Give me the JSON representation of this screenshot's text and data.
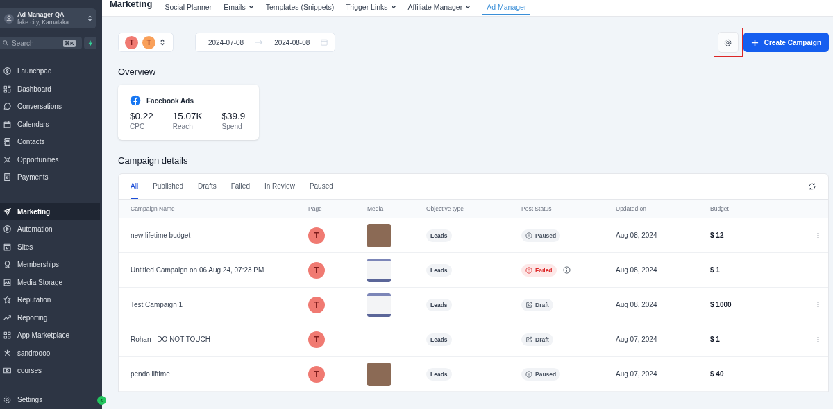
{
  "account": {
    "name": "Ad Manager QA",
    "location": "fake city, Karnataka"
  },
  "search": {
    "placeholder": "Search",
    "shortcut": "⌘K"
  },
  "sidebar": {
    "items": [
      {
        "label": "Launchpad",
        "selected": false
      },
      {
        "label": "Dashboard",
        "selected": false
      },
      {
        "label": "Conversations",
        "selected": false
      },
      {
        "label": "Calendars",
        "selected": false
      },
      {
        "label": "Contacts",
        "selected": false
      },
      {
        "label": "Opportunities",
        "selected": false
      },
      {
        "label": "Payments",
        "selected": false
      }
    ],
    "items_2": [
      {
        "label": "Marketing",
        "selected": true
      },
      {
        "label": "Automation",
        "selected": false
      },
      {
        "label": "Sites",
        "selected": false
      },
      {
        "label": "Memberships",
        "selected": false
      },
      {
        "label": "Media Storage",
        "selected": false
      },
      {
        "label": "Reputation",
        "selected": false
      },
      {
        "label": "Reporting",
        "selected": false
      },
      {
        "label": "App Marketplace",
        "selected": false
      },
      {
        "label": "sandroooo",
        "selected": false
      },
      {
        "label": "courses",
        "selected": false
      }
    ],
    "footer": {
      "label": "Settings"
    }
  },
  "header": {
    "title": "Marketing",
    "tabs": [
      {
        "label": "Social Planner",
        "has_menu": false,
        "selected": false
      },
      {
        "label": "Emails",
        "has_menu": true,
        "selected": false
      },
      {
        "label": "Templates (Snippets)",
        "has_menu": false,
        "selected": false
      },
      {
        "label": "Trigger Links",
        "has_menu": true,
        "selected": false
      },
      {
        "label": "Affiliate Manager",
        "has_menu": true,
        "selected": false
      },
      {
        "label": "Ad Manager",
        "has_menu": false,
        "selected": true
      }
    ]
  },
  "filters": {
    "pages": [
      {
        "letter": "T",
        "color": "#f07a72"
      },
      {
        "letter": "T",
        "color": "#f9a05a"
      }
    ],
    "date_from": "2024-07-08",
    "date_to": "2024-08-08"
  },
  "settings_button": {
    "highlighted": true
  },
  "create_button": {
    "label": "Create Campaign"
  },
  "overview": {
    "title": "Overview",
    "card": {
      "title": "Facebook Ads",
      "metrics": [
        {
          "value": "$0.22",
          "label": "CPC"
        },
        {
          "value": "15.07K",
          "label": "Reach"
        },
        {
          "value": "$39.9",
          "label": "Spend"
        }
      ]
    }
  },
  "campaigns": {
    "title": "Campaign details",
    "tabs": [
      {
        "label": "All",
        "selected": true
      },
      {
        "label": "Published",
        "selected": false
      },
      {
        "label": "Drafts",
        "selected": false
      },
      {
        "label": "Failed",
        "selected": false
      },
      {
        "label": "In Review",
        "selected": false
      },
      {
        "label": "Paused",
        "selected": false
      }
    ],
    "table": {
      "columns": [
        "Campaign Name",
        "Page",
        "Media",
        "Objective type",
        "Post Status",
        "Updated on",
        "Budget"
      ],
      "rows": [
        {
          "name": "new lifetime budget",
          "page": "T",
          "media": {
            "kind": "photo"
          },
          "objective": "Leads",
          "status": {
            "kind": "paused",
            "label": "Paused"
          },
          "updated": "Aug 08, 2024",
          "budget": "$ 12"
        },
        {
          "name": "Untitled Campaign on 06 Aug 24, 07:23 PM",
          "page": "T",
          "media": {
            "kind": "screenshot"
          },
          "objective": "Leads",
          "status": {
            "kind": "failed",
            "label": "Failed"
          },
          "updated": "Aug 08, 2024",
          "budget": "$ 1"
        },
        {
          "name": "Test Campaign 1",
          "page": "T",
          "media": {
            "kind": "screenshot"
          },
          "objective": "Leads",
          "status": {
            "kind": "draft",
            "label": "Draft"
          },
          "updated": "Aug 08, 2024",
          "budget": "$ 1000"
        },
        {
          "name": "Rohan  - DO NOT TOUCH",
          "page": "T",
          "objective": "Leads",
          "status": {
            "kind": "draft",
            "label": "Draft"
          },
          "updated": "Aug 07, 2024",
          "budget": "$ 1"
        },
        {
          "name": "pendo liftime",
          "page": "T",
          "media": {
            "kind": "photo"
          },
          "objective": "Leads",
          "status": {
            "kind": "paused",
            "label": "Paused"
          },
          "updated": "Aug 07, 2024",
          "budget": "$ 40"
        }
      ]
    }
  }
}
